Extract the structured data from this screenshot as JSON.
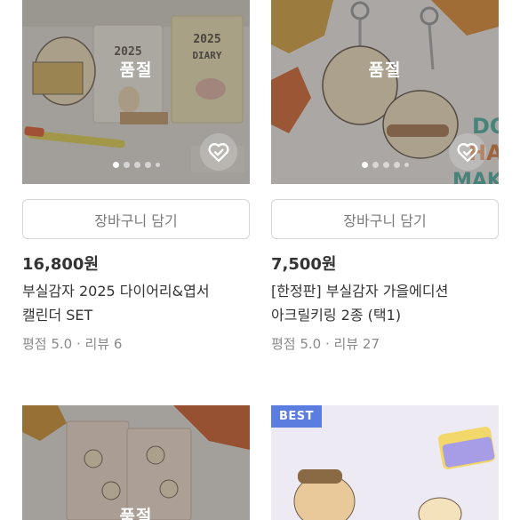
{
  "products": [
    {
      "status_label": "품절",
      "cart_label": "장바구니 담기",
      "price": "16,800원",
      "title_line1": "부실감자 2025 다이어리&엽서",
      "title_line2": "캘린더 SET",
      "rating": "평점 5.0 · 리뷰 6",
      "image_text_a": "2025",
      "image_text_b": "2025",
      "image_text_c": "DIARY",
      "carousel": {
        "total": 5,
        "active": 1
      }
    },
    {
      "status_label": "품절",
      "cart_label": "장바구니 담기",
      "price": "7,500원",
      "title_line1": "[한정판] 부실감자 가을에디션",
      "title_line2": "아크릴키링 2종 (택1)",
      "rating": "평점 5.0 · 리뷰 27",
      "image_text_a": "DO",
      "image_text_b": "HA",
      "image_text_c": "MAKE",
      "carousel": {
        "total": 5,
        "active": 1
      }
    },
    {
      "status_label": "품절"
    },
    {
      "badge": "BEST"
    }
  ],
  "colors": {
    "best_badge": "#5b7ddf",
    "soldout_overlay": "#464646",
    "button_border": "#d6d6d6",
    "muted_text": "#8a8a8a"
  },
  "icons": [
    "heart-check-icon",
    "carousel-dot-icon"
  ]
}
